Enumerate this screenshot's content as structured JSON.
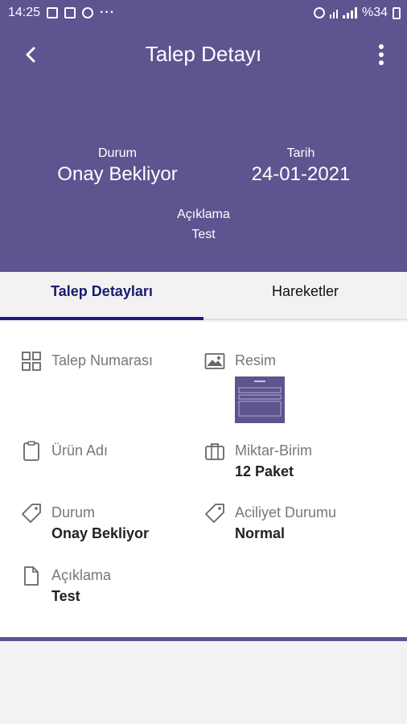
{
  "status_bar": {
    "time": "14:25",
    "battery": "%34"
  },
  "header": {
    "title": "Talep Detayı",
    "status_label": "Durum",
    "status_value": "Onay Bekliyor",
    "date_label": "Tarih",
    "date_value": "24-01-2021",
    "description_label": "Açıklama",
    "description_value": "Test"
  },
  "tabs": [
    {
      "label": "Talep Detayları",
      "active": true
    },
    {
      "label": "Hareketler",
      "active": false
    }
  ],
  "details": {
    "request_number_label": "Talep Numarası",
    "request_number_value": "",
    "image_label": "Resim",
    "product_name_label": "Ürün Adı",
    "product_name_value": "",
    "quantity_unit_label": "Miktar-Birim",
    "quantity_unit_value": "12 Paket",
    "status_label": "Durum",
    "status_value": "Onay Bekliyor",
    "urgency_label": "Aciliyet Durumu",
    "urgency_value": "Normal",
    "description_label": "Açıklama",
    "description_value": "Test"
  },
  "icons": {
    "back": "arrow-left-icon",
    "menu": "more-vertical-icon",
    "request_number": "grid-icon",
    "image": "image-icon",
    "product": "clipboard-icon",
    "quantity": "briefcase-icon",
    "status": "tag-icon",
    "urgency": "tag-icon",
    "description": "file-icon"
  },
  "colors": {
    "primary": "#5d5490",
    "tab_indicator": "#1e1e80"
  }
}
